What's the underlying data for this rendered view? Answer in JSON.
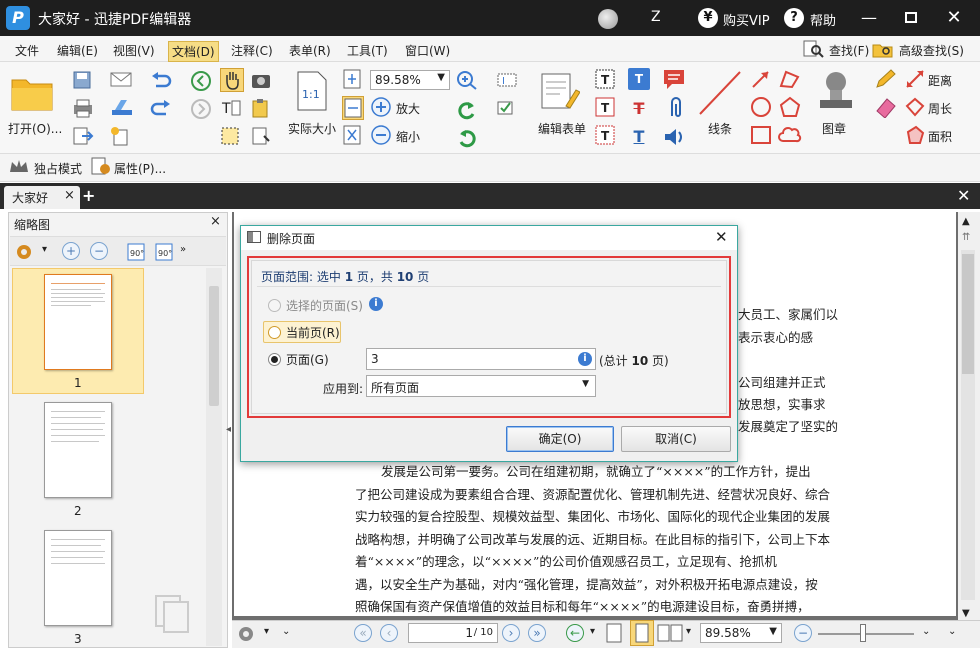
{
  "window": {
    "title": "大家好 - 迅捷PDF编辑器",
    "user_initial": "Z",
    "vip_label": "购买VIP",
    "help_label": "帮助",
    "vip_symbol": "¥",
    "help_symbol": "?"
  },
  "menu": [
    "文件",
    "编辑(E)",
    "视图(V)",
    "文档(D)",
    "注释(C)",
    "表单(R)",
    "工具(T)",
    "窗口(W)"
  ],
  "menu_right": {
    "find": "查找(F)",
    "advanced_find": "高级查找(S)"
  },
  "ribbon": {
    "open": "打开(O)...",
    "zoom_value": "89.58%",
    "actual_size": "实际大小",
    "zoom_in": "放大",
    "zoom_out": "缩小",
    "edit_form": "编辑表单",
    "line": "线条",
    "stamp": "图章",
    "distance": "距离",
    "perimeter": "周长",
    "area": "面积"
  },
  "toolbar2": {
    "exclusive_mode": "独占模式",
    "properties": "属性(P)..."
  },
  "tab": {
    "name": "大家好",
    "close": "×",
    "add": "+"
  },
  "thumbnail_panel": {
    "title": "缩略图",
    "close": "×",
    "pages": [
      "1",
      "2",
      "3"
    ]
  },
  "document_text": [
    "大员工、家属们以",
    "表示衷心的感",
    "公司组建并正式",
    "放思想，实事求",
    "发展奠定了坚实的",
    "发展是公司第一要务。公司在组建初期，就确立了“××××”的工作方针，提出",
    "了把公司建设成为要素组合合理、资源配置优化、管理机制先进、经营状况良好、综合",
    "实力较强的复合控股型、规模效益型、集团化、市场化、国际化的现代企业集团的发展",
    "战略构想，并明确了公司改革与发展的远、近期目标。在此目标的指引下，公司上下本",
    "着“××××”的理念，以“××××”的公司价值观感召员工，立足现有、抢抓机",
    "遇，以安全生产为基础，对内“强化管理，提高效益”，对外积极开拓电源点建设，按",
    "照确保国有资产保值增值的效益目标和每年“××××”的电源建设目标，奋勇拼搏，"
  ],
  "dialog": {
    "title": "删除页面",
    "close": "✕",
    "range_prefix": "页面范围: 选中 ",
    "range_selected": "1",
    "range_mid": " 页，共 ",
    "range_total": "10",
    "range_suffix": " 页",
    "opt_selected": "选择的页面(S)",
    "opt_current": "当前页(R)",
    "opt_pages": "页面(G)",
    "pages_value": "3",
    "total_prefix": "(总计 ",
    "total_count": "10",
    "total_suffix": " 页)",
    "apply_to_label": "应用到:",
    "apply_to_value": "所有页面",
    "ok": "确定(O)",
    "cancel": "取消(C)",
    "info": "i"
  },
  "bottom": {
    "page_input": "1",
    "page_total": "/ 10",
    "zoom": "89.58%"
  },
  "colors": {
    "titlebar": "#1e1e1e",
    "accent_red": "#e23a3a",
    "dialog_border": "#3aa8a0",
    "thumb_selected": "#fdebb0"
  }
}
